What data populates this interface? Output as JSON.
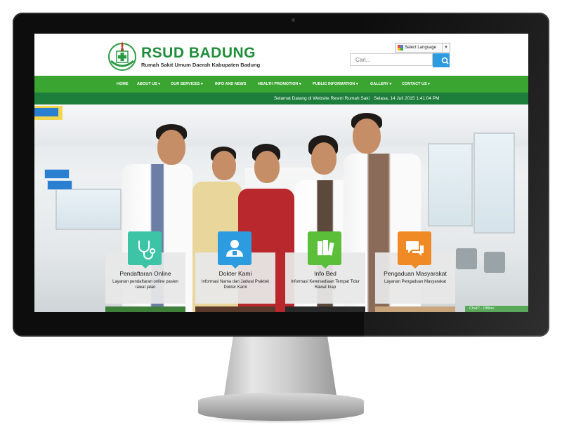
{
  "header": {
    "brand_title": "RSUD BADUNG",
    "brand_subtitle": "Rumah Sakit Umum Daerah Kabupaten Badung",
    "language_selector": "Select Language",
    "search_placeholder": "Cari...",
    "search_icon": "search-icon"
  },
  "nav": {
    "items": [
      "HOME",
      "ABOUT US ▾",
      "OUR SERVICES ▾",
      "INFO AND NEWS",
      "HEALTH PROMOTION ▾",
      "PUBLIC INFORMATION ▾",
      "GALLERY ▾",
      "CONTACT US ▾"
    ]
  },
  "ticker": {
    "message": "Selamat Datang di Website Resmi Rumah Saki",
    "datetime": "Selasa, 14 Juli 2015 1:41:04 PM"
  },
  "cards": [
    {
      "title": "Pendaftaran Online",
      "desc": "Layanan pendaftaran online pasien rawat jalan",
      "icon": "stethoscope-icon",
      "color": "#3dc3a6"
    },
    {
      "title": "Dokter Kami",
      "desc": "Informasi Nama dan Jadwal Praktek Dokter Kami",
      "icon": "doctor-icon",
      "color": "#2d9be0"
    },
    {
      "title": "Info Bed",
      "desc": "Informasi Ketersediaan Tempat Tidur Rawat Inap",
      "icon": "books-icon",
      "color": "#5cbf3a"
    },
    {
      "title": "Pengaduan Masyarakat",
      "desc": "Layanan Pengaduan Masyarakat",
      "icon": "chat-bubbles-icon",
      "color": "#f08a24"
    }
  ],
  "chat": {
    "label": "Chat? - Offline"
  }
}
